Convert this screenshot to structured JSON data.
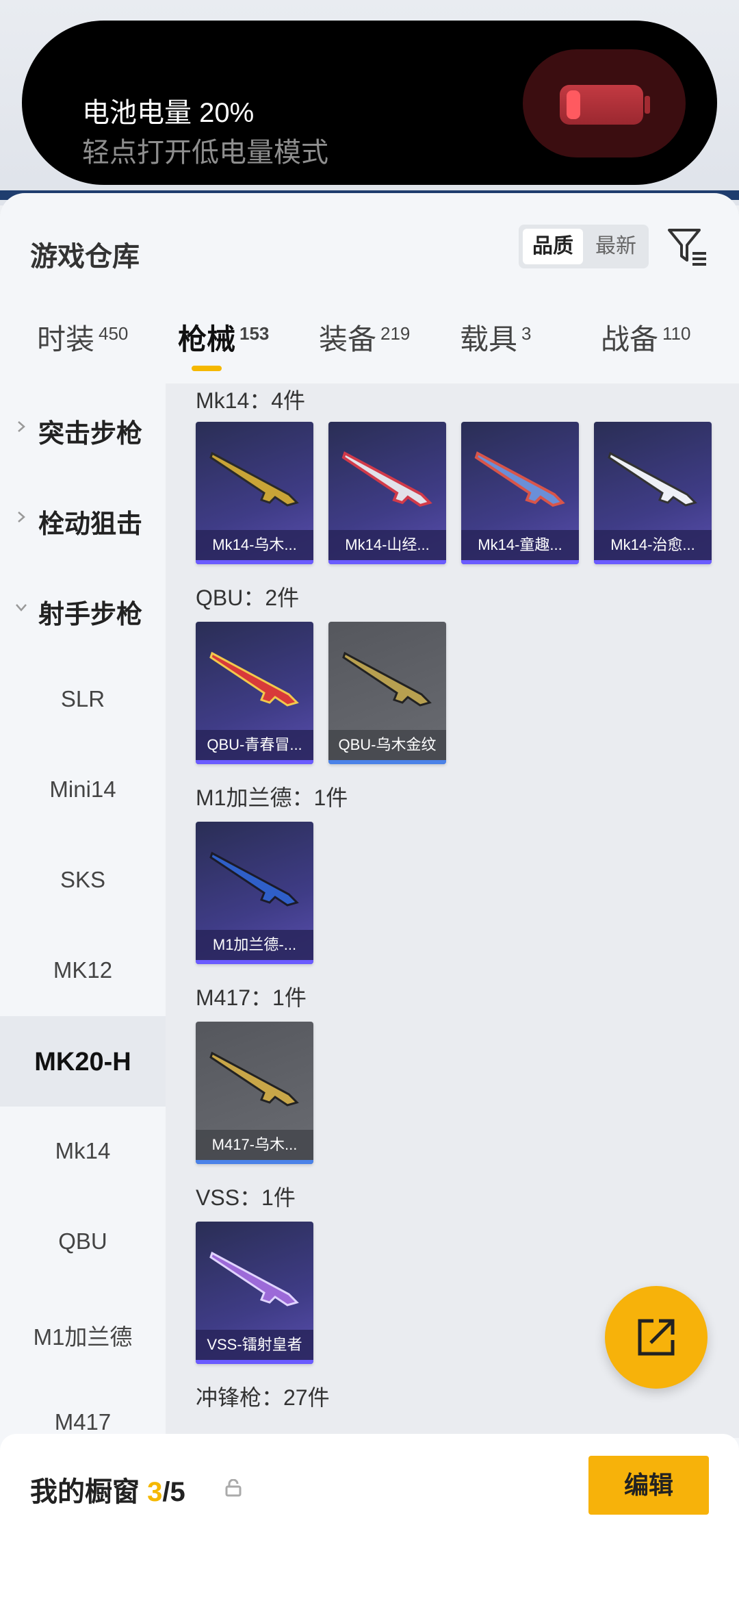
{
  "status_pill": {
    "line1": "电池电量 20%",
    "line2": "轻点打开低电量模式",
    "battery_level": 0.2
  },
  "header": {
    "title": "游戏仓库",
    "sort": {
      "quality": "品质",
      "newest": "最新"
    },
    "filter_icon": "filter-icon"
  },
  "tabs": [
    {
      "label": "时装",
      "count": "450"
    },
    {
      "label": "枪械",
      "count": "153"
    },
    {
      "label": "装备",
      "count": "219"
    },
    {
      "label": "载具",
      "count": "3"
    },
    {
      "label": "战备",
      "count": "110"
    }
  ],
  "sidebar": {
    "categories": [
      "突击步枪",
      "栓动狙击",
      "射手步枪"
    ],
    "items": [
      "SLR",
      "Mini14",
      "SKS",
      "MK12",
      "MK20-H",
      "Mk14",
      "QBU",
      "M1加兰德",
      "M417"
    ],
    "selected": "MK20-H"
  },
  "groups": [
    {
      "title": "Mk14：4件",
      "items": [
        "Mk14-乌木...",
        "Mk14-山经...",
        "Mk14-童趣...",
        "Mk14-治愈..."
      ]
    },
    {
      "title": "QBU：2件",
      "items": [
        "QBU-青春冒...",
        "QBU-乌木金纹"
      ]
    },
    {
      "title": "M1加兰德：1件",
      "items": [
        "M1加兰德-..."
      ]
    },
    {
      "title": "M417：1件",
      "items": [
        "M417-乌木..."
      ]
    },
    {
      "title": "VSS：1件",
      "items": [
        "VSS-镭射皇者"
      ]
    },
    {
      "title": "冲锋枪：27件",
      "items": []
    }
  ],
  "bottom": {
    "label": "我的橱窗",
    "count": "3",
    "total": "/5",
    "edit": "编辑"
  },
  "colors": {
    "accent": "#f7b20a",
    "card_purple": "#3f3c86",
    "card_gray": "#5f6167"
  }
}
